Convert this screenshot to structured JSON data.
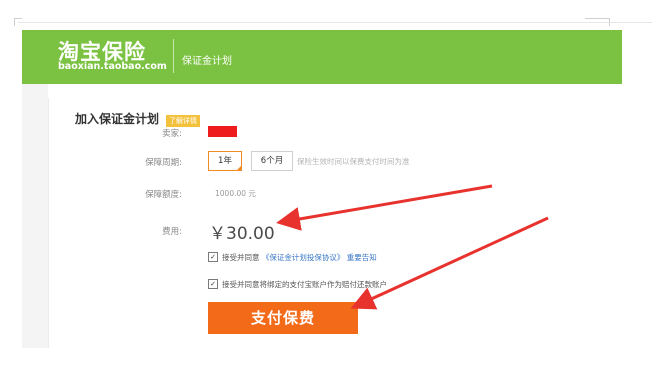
{
  "banner": {
    "logo_main": "淘宝保险",
    "logo_sub": "baoxian.taobao.com",
    "plan_name": "保证金计划"
  },
  "section": {
    "title": "加入保证金计划",
    "detail_tag": "了解详情"
  },
  "form": {
    "seller_label": "卖家:",
    "period_label": "保障周期:",
    "period_options": [
      "1年",
      "6个月"
    ],
    "period_selected": "1年",
    "period_hint": "保险生效时间以保费支付时间为准",
    "amount_label": "保障额度:",
    "amount_value": "1000.00 元",
    "fee_label": "费用:",
    "fee_value": "￥30.00",
    "agree1_prefix": "接受并同意",
    "agree1_link": "《保证金计划投保协议》",
    "agree1_suffix": "重要告知",
    "agree2_text": "接受并同意将绑定的支付宝账户作为赔付还款账户",
    "pay_button": "支付保费"
  },
  "colors": {
    "banner_green": "#7cc242",
    "pay_orange": "#f36a19",
    "annotation_red": "#e8322e",
    "seller_redacted": "#ee1c1c"
  }
}
